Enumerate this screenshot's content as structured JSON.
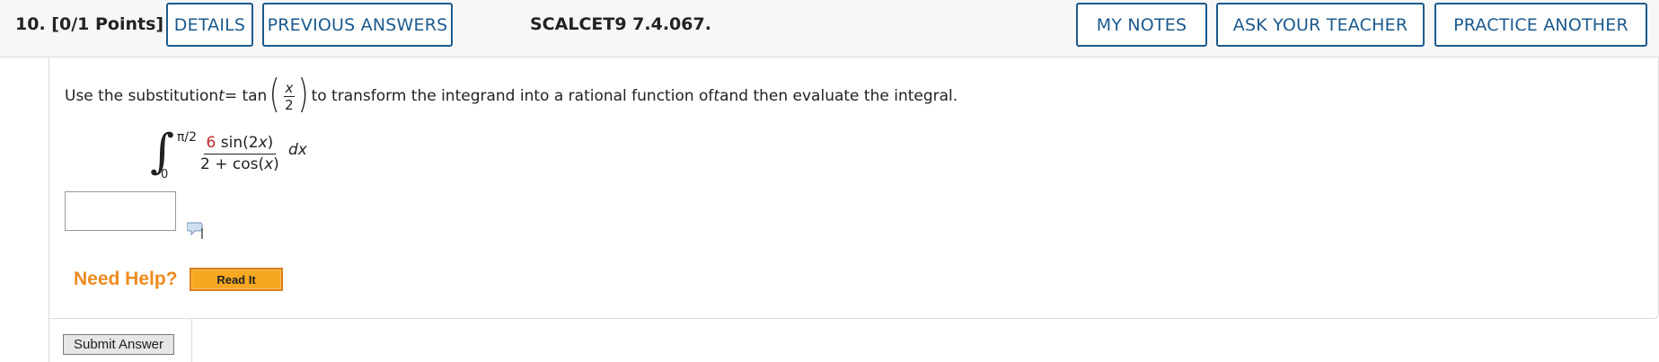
{
  "header": {
    "question_number": "10.",
    "points": "[0/1 Points]",
    "details_label": "DETAILS",
    "previous_answers_label": "PREVIOUS ANSWERS",
    "problem_code": "SCALCET9 7.4.067.",
    "my_notes_label": "MY NOTES",
    "ask_teacher_label": "ASK YOUR TEACHER",
    "practice_another_label": "PRACTICE ANOTHER"
  },
  "question": {
    "text_before": "Use the substitution ",
    "var_t": "t",
    "equals_tan": " = tan",
    "frac_num": "x",
    "frac_den": "2",
    "text_after": " to transform the integrand into a rational function of ",
    "var_t2": "t",
    "text_end": " and then evaluate the integral."
  },
  "integral": {
    "upper_limit": "π/2",
    "lower_limit": "0",
    "numerator_coef": "6",
    "numerator_func": " sin(2",
    "numerator_var": "x",
    "numerator_close": ")",
    "denominator_pre": "2 + cos(",
    "denominator_var": "x",
    "denominator_close": ")",
    "differential": "dx"
  },
  "answer": {
    "value": ""
  },
  "help": {
    "label": "Need Help?",
    "read_it_label": "Read It"
  },
  "submit_label": "Submit Answer",
  "colors": {
    "accent": "#1b5a8e",
    "help": "#ef8a1f",
    "coef": "#c0282f"
  }
}
